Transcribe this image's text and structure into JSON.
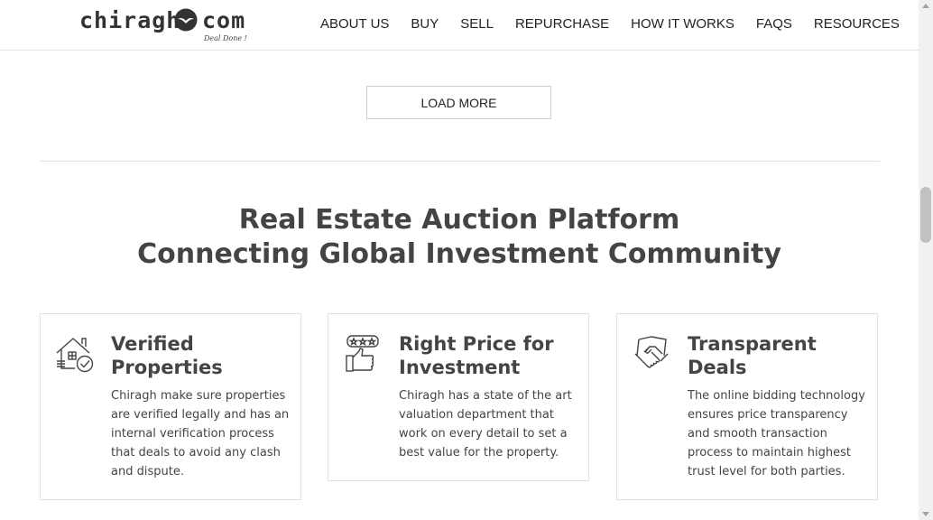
{
  "header": {
    "logo": {
      "name": "chiragh",
      "suffix": "com",
      "tagline": "Deal Done !"
    },
    "nav": [
      "ABOUT US",
      "BUY",
      "SELL",
      "REPURCHASE",
      "HOW IT WORKS",
      "FAQS",
      "RESOURCES"
    ]
  },
  "main": {
    "load_more_label": "LOAD MORE",
    "headline": {
      "line1": "Real Estate Auction Platform",
      "line2": "Connecting Global Investment Community"
    },
    "features": [
      {
        "icon": "house-check-icon",
        "title": "Verified Properties",
        "text": "Chiragh make sure properties are verified legally and has an internal verification process that deals to avoid any clash and dispute."
      },
      {
        "icon": "thumbs-up-stars-icon",
        "title": "Right Price for Investment",
        "text": "Chiragh has a state of the art valuation department that work on every detail to set a best value for the property."
      },
      {
        "icon": "handshake-icon",
        "title": "Transparent Deals",
        "text": "The online bidding technology ensures price transparency and smooth transaction process to maintain highest trust level for both parties."
      }
    ]
  }
}
